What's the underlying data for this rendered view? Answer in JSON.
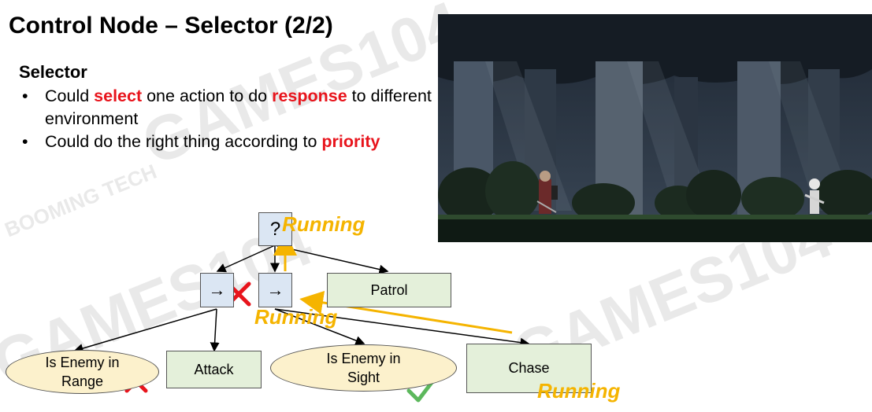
{
  "slide": {
    "title": "Control Node – Selector (2/2)",
    "subheading": "Selector",
    "bullet_symbol": "•",
    "bullet1": {
      "p1": "Could ",
      "h1": "select",
      "p2": " one action to do ",
      "h2": "response",
      "p3": " to different environment"
    },
    "bullet2": {
      "p1": "Could do the right thing according to ",
      "h1": "priority"
    }
  },
  "watermarks": {
    "games": "GAMES104",
    "booming": "BOOMING TECH"
  },
  "tree": {
    "selector_symbol": "?",
    "sequence_symbol": "→",
    "patrol": "Patrol",
    "enemy_in_range": "Is Enemy in Range",
    "attack": "Attack",
    "enemy_in_sight": "Is Enemy in Sight",
    "chase": "Chase",
    "running": "Running"
  },
  "colors": {
    "highlight": "#e8141c",
    "running": "#f5b400",
    "fail_cross": "#e8141c",
    "success_check": "#5cb85c"
  }
}
